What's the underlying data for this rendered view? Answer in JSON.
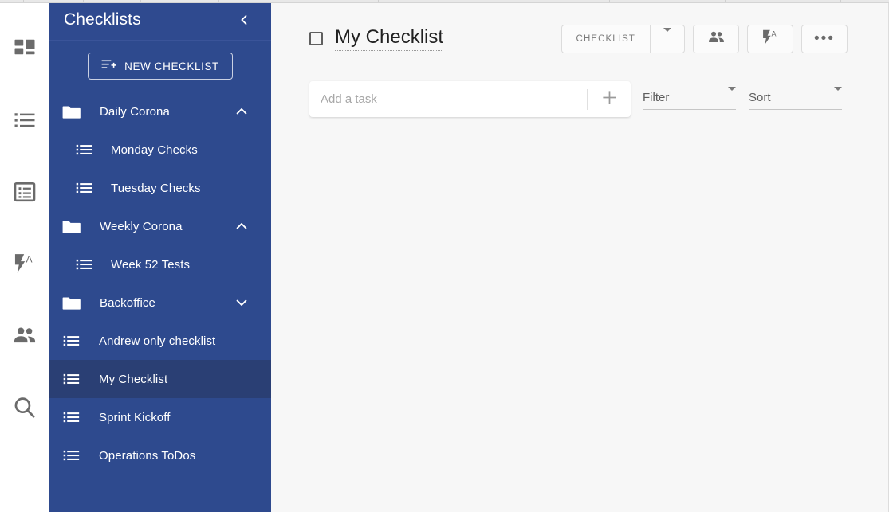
{
  "colors": {
    "sidebar_bg": "#2e4a8e",
    "sidebar_header_bg": "#2f4a8f",
    "sidebar_selected_bg": "#2a3f74",
    "main_bg": "#f7f7f7",
    "rail_bg": "#ffffff",
    "icon_grey": "#6b6b6b",
    "title_text": "#212121"
  },
  "rail": {
    "items": [
      {
        "name": "dashboard-icon",
        "label": "Dashboard"
      },
      {
        "name": "list-icon",
        "label": "Lists"
      },
      {
        "name": "list-box-icon",
        "label": "Templates"
      },
      {
        "name": "automation-icon",
        "label": "Automations"
      },
      {
        "name": "people-icon",
        "label": "Teams"
      },
      {
        "name": "search-icon",
        "label": "Search"
      }
    ]
  },
  "sidebar": {
    "title": "Checklists",
    "collapse_icon": "chevron-left-icon",
    "new_checklist_label": "NEW CHECKLIST",
    "new_checklist_icon": "list-plus-icon",
    "tree": [
      {
        "type": "folder",
        "label": "Daily Corona",
        "chevron": "chevron-up-icon",
        "expanded": true
      },
      {
        "type": "list",
        "label": "Monday Checks",
        "indent": "child",
        "selected": false
      },
      {
        "type": "list",
        "label": "Tuesday Checks",
        "indent": "child",
        "selected": false
      },
      {
        "type": "folder",
        "label": "Weekly Corona",
        "chevron": "chevron-up-icon",
        "expanded": true
      },
      {
        "type": "list",
        "label": "Week 52 Tests",
        "indent": "child",
        "selected": false
      },
      {
        "type": "folder",
        "label": "Backoffice",
        "chevron": "chevron-down-icon",
        "expanded": false
      },
      {
        "type": "list",
        "label": "Andrew only checklist",
        "indent": "root",
        "selected": false
      },
      {
        "type": "list",
        "label": "My Checklist",
        "indent": "root",
        "selected": true
      },
      {
        "type": "list",
        "label": "Sprint Kickoff",
        "indent": "root",
        "selected": false
      },
      {
        "type": "list",
        "label": "Operations ToDos",
        "indent": "root",
        "selected": false
      }
    ]
  },
  "main": {
    "title": "My Checklist",
    "title_checkbox_checked": false,
    "actions": {
      "type_label": "CHECKLIST",
      "type_caret_icon": "chevron-down-icon",
      "share_icon": "people-icon",
      "automation_icon": "automation-icon",
      "more_icon": "ellipsis-icon",
      "more_label": "•••"
    },
    "add_task": {
      "placeholder": "Add a task",
      "value": "",
      "add_icon": "plus-icon"
    },
    "filter": {
      "label": "Filter",
      "caret_icon": "chevron-down-icon"
    },
    "sort": {
      "label": "Sort",
      "caret_icon": "chevron-down-icon"
    }
  }
}
